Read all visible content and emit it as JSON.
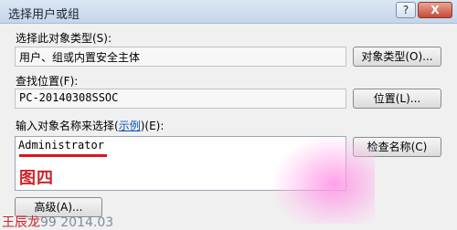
{
  "window": {
    "title": "选择用户或组",
    "help_label": "?",
    "close_label": "X"
  },
  "object_type": {
    "label": "选择此对象类型(S):",
    "value": "用户、组或内置安全主体",
    "button": "对象类型(O)..."
  },
  "location": {
    "label": "查找位置(F):",
    "value": "PC-20140308SSOC",
    "button": "位置(L)..."
  },
  "names": {
    "label_prefix": "输入对象名称来选择(",
    "label_link": "示例",
    "label_suffix": ")(E):",
    "value": "Administrator",
    "check_button": "检查名称(C)"
  },
  "annotation": {
    "caption": "图四"
  },
  "footer": {
    "advanced_button": "高级(A)..."
  },
  "watermark": {
    "name": "王辰龙",
    "number": "99 2014.03"
  },
  "colors": {
    "annotation_red": "#d8141c",
    "link_blue": "#0b53b5"
  }
}
